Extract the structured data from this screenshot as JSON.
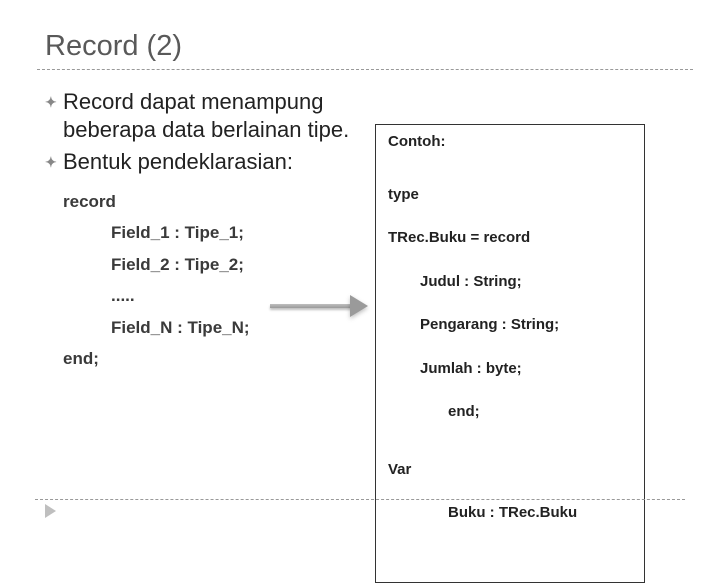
{
  "slide": {
    "title": "Record (2)",
    "bullets": [
      "Record dapat menampung beberapa data berlainan tipe.",
      "Bentuk pendeklarasian:"
    ],
    "syntax": {
      "keyword_record": "record",
      "field1": "Field_1 : Tipe_1;",
      "field2": "Field_2 : Tipe_2;",
      "dots": ".....",
      "fieldn": "Field_N : Tipe_N;",
      "keyword_end": "end;"
    },
    "example": {
      "label": "Contoh:",
      "type_kw": "type",
      "type_decl": "TRec.Buku = record",
      "fields": [
        "Judul : String;",
        "Pengarang : String;",
        "Jumlah : byte;",
        "end;"
      ],
      "var_kw": "Var",
      "var_decl": "Buku : TRec.Buku"
    }
  }
}
